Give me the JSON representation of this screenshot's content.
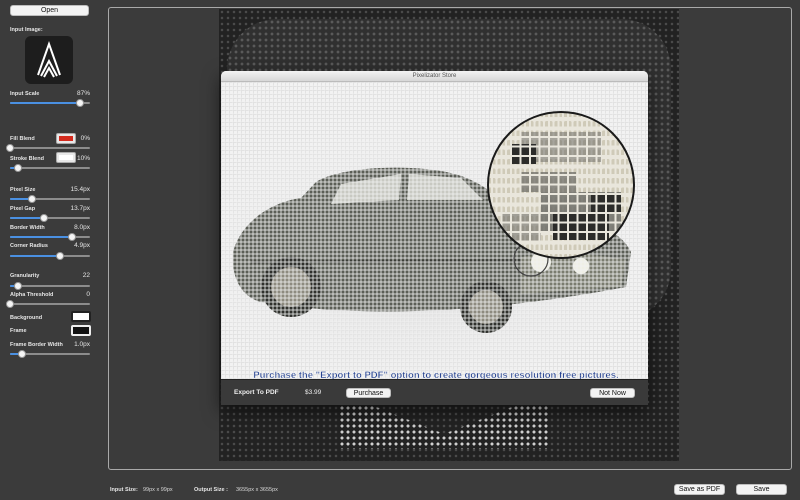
{
  "sidebar": {
    "open_label": "Open",
    "input_image_label": "Input Image:",
    "input_scale": {
      "label": "Input Scale",
      "value": "87%",
      "level": 0.87
    },
    "fill_blend": {
      "label": "Fill Blend",
      "value": "0%",
      "level": 0.0,
      "color": "#d42b1e"
    },
    "stroke_blend": {
      "label": "Stroke Blend",
      "value": "10%",
      "level": 0.1,
      "color": "#ffffff"
    },
    "pixel_size": {
      "label": "Pixel Size",
      "value": "15.4px",
      "level": 0.27
    },
    "pixel_gap": {
      "label": "Pixel Gap",
      "value": "13.7px",
      "level": 0.43
    },
    "border_width": {
      "label": "Border Width",
      "value": "8.0px",
      "level": 0.78
    },
    "corner_radius": {
      "label": "Corner Radius",
      "value": "4.9px",
      "level": 0.63
    },
    "granularity": {
      "label": "Granularity",
      "value": "22",
      "level": 0.1
    },
    "alpha_threshold": {
      "label": "Alpha Threshold",
      "value": "0",
      "level": 0.0
    },
    "background": {
      "label": "Background"
    },
    "frame": {
      "label": "Frame"
    },
    "frame_border_width": {
      "label": "Frame Border Width",
      "value": "1.0px",
      "level": 0.15
    }
  },
  "store": {
    "title": "Pixelizator Store",
    "promo": "Purchase the \"Export to PDF\" option to create gorgeous resolution free pictures.",
    "product": "Export To PDF",
    "price": "$3.99",
    "purchase_label": "Purchase",
    "not_now_label": "Not Now"
  },
  "bottom": {
    "input_size_label": "Input Size:",
    "input_size_value": "99px x 99px",
    "output_size_label": "Output Size :",
    "output_size_value": "3655px x 3655px",
    "save_pdf_label": "Save as PDF",
    "save_label": "Save"
  }
}
